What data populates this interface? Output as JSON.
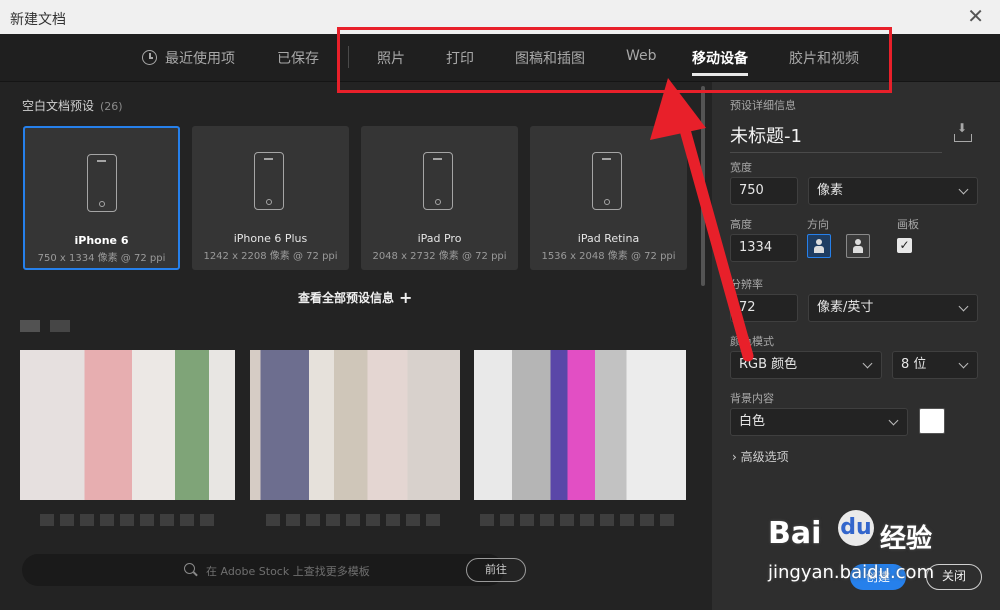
{
  "window": {
    "title": "新建文档",
    "close_glyph": "✕"
  },
  "tabs": [
    {
      "label": "最近使用项",
      "active": false
    },
    {
      "label": "已保存",
      "active": false
    },
    {
      "label": "照片",
      "active": false
    },
    {
      "label": "打印",
      "active": false
    },
    {
      "label": "图稿和插图",
      "active": false
    },
    {
      "label": "Web",
      "active": false
    },
    {
      "label": "移动设备",
      "active": true
    },
    {
      "label": "胶片和视频",
      "active": false
    }
  ],
  "presets_section": {
    "title": "空白文档预设",
    "count": "(26)",
    "items": [
      {
        "name": "iPhone 6",
        "size": "750 x 1334 像素 @ 72 ppi",
        "selected": true
      },
      {
        "name": "iPhone 6 Plus",
        "size": "1242 x 2208 像素 @ 72 ppi",
        "selected": false
      },
      {
        "name": "iPad Pro",
        "size": "2048 x 2732 像素 @ 72 ppi",
        "selected": false
      },
      {
        "name": "iPad Retina",
        "size": "1536 x 2048 像素 @ 72 ppi",
        "selected": false
      }
    ],
    "view_all": "查看全部预设信息",
    "view_all_glyph": "+"
  },
  "stock": {
    "placeholder": "在 Adobe Stock 上查找更多模板",
    "go_button": "前往"
  },
  "details": {
    "header": "预设详细信息",
    "doc_name": "未标题-1",
    "width_label": "宽度",
    "width_value": "750",
    "width_unit": "像素",
    "height_label": "高度",
    "height_value": "1334",
    "orientation_label": "方向",
    "artboard_label": "画板",
    "artboard_checked": "✓",
    "resolution_label": "分辨率",
    "resolution_value": "72",
    "resolution_unit": "像素/英寸",
    "color_mode_label": "颜色模式",
    "color_mode_value": "RGB 颜色",
    "bit_depth": "8 位",
    "background_label": "背景内容",
    "background_value": "白色",
    "background_color": "#ffffff",
    "advanced": "高级选项",
    "advanced_glyph": "›",
    "create_button": "创建",
    "close_button": "关闭"
  },
  "watermark": {
    "brand": "Bai",
    "brand_mid": "du",
    "brand_cn": "经验",
    "url": "jingyan.baidu.com"
  },
  "colors": {
    "accent": "#2680eb",
    "annotation_red": "#e8202a"
  }
}
